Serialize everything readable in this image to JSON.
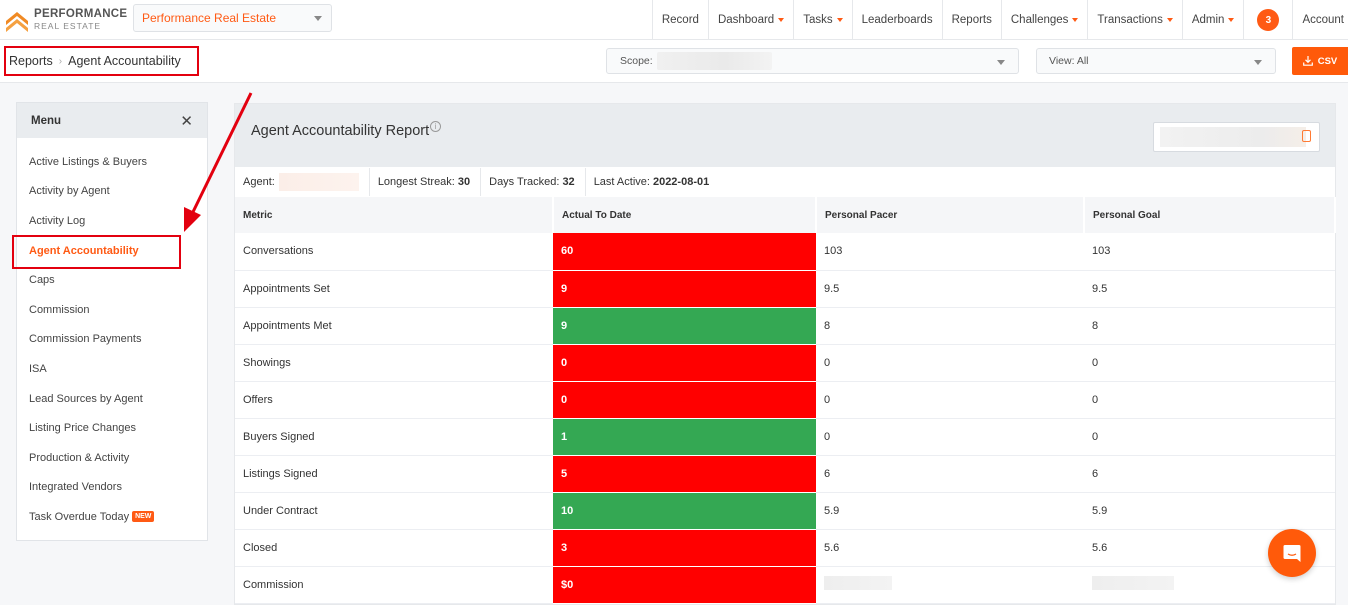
{
  "brand": {
    "name_line1": "PERFORMANCE",
    "name_line2": "REAL ESTATE",
    "accent_color": "#ff5a14"
  },
  "org_select": {
    "value": "Performance Real Estate"
  },
  "nav": {
    "items": [
      {
        "label": "Record",
        "dropdown": false
      },
      {
        "label": "Dashboard",
        "dropdown": true
      },
      {
        "label": "Tasks",
        "dropdown": true
      },
      {
        "label": "Leaderboards",
        "dropdown": false
      },
      {
        "label": "Reports",
        "dropdown": false
      },
      {
        "label": "Challenges",
        "dropdown": true
      },
      {
        "label": "Transactions",
        "dropdown": true
      },
      {
        "label": "Admin",
        "dropdown": true
      }
    ],
    "notification_count": "3",
    "account_label": "Account"
  },
  "breadcrumb": {
    "parent": "Reports",
    "separator": "›",
    "current": "Agent Accountability"
  },
  "filters": {
    "scope_label": "Scope:",
    "view_label": "View: All",
    "csv_label": "CSV"
  },
  "menu": {
    "title": "Menu",
    "items": [
      {
        "label": "Active Listings & Buyers"
      },
      {
        "label": "Activity by Agent"
      },
      {
        "label": "Activity Log"
      },
      {
        "label": "Agent Accountability",
        "active": true
      },
      {
        "label": "Caps"
      },
      {
        "label": "Commission"
      },
      {
        "label": "Commission Payments"
      },
      {
        "label": "ISA"
      },
      {
        "label": "Lead Sources by Agent"
      },
      {
        "label": "Listing Price Changes"
      },
      {
        "label": "Production & Activity"
      },
      {
        "label": "Integrated Vendors"
      },
      {
        "label": "Task Overdue Today",
        "badge": "NEW"
      }
    ]
  },
  "report": {
    "title": "Agent Accountability Report",
    "stats": {
      "agent_label": "Agent:",
      "longest_streak_label": "Longest Streak:",
      "longest_streak": "30",
      "days_tracked_label": "Days Tracked:",
      "days_tracked": "32",
      "last_active_label": "Last Active:",
      "last_active": "2022-08-01"
    },
    "columns": [
      "Metric",
      "Actual To Date",
      "Personal Pacer",
      "Personal Goal"
    ],
    "status_colors": {
      "below": "#ff0000",
      "above": "#34a853"
    },
    "rows": [
      {
        "metric": "Conversations",
        "actual": "60",
        "status": "red",
        "pacer": "103",
        "goal": "103"
      },
      {
        "metric": "Appointments Set",
        "actual": "9",
        "status": "red",
        "pacer": "9.5",
        "goal": "9.5"
      },
      {
        "metric": "Appointments Met",
        "actual": "9",
        "status": "green",
        "pacer": "8",
        "goal": "8"
      },
      {
        "metric": "Showings",
        "actual": "0",
        "status": "red",
        "pacer": "0",
        "goal": "0"
      },
      {
        "metric": "Offers",
        "actual": "0",
        "status": "red",
        "pacer": "0",
        "goal": "0"
      },
      {
        "metric": "Buyers Signed",
        "actual": "1",
        "status": "green",
        "pacer": "0",
        "goal": "0"
      },
      {
        "metric": "Listings Signed",
        "actual": "5",
        "status": "red",
        "pacer": "6",
        "goal": "6"
      },
      {
        "metric": "Under Contract",
        "actual": "10",
        "status": "green",
        "pacer": "5.9",
        "goal": "5.9"
      },
      {
        "metric": "Closed",
        "actual": "3",
        "status": "red",
        "pacer": "5.6",
        "goal": "5.6"
      },
      {
        "metric": "Commission",
        "actual": "$0",
        "status": "red",
        "pacer": null,
        "goal": null
      }
    ]
  }
}
